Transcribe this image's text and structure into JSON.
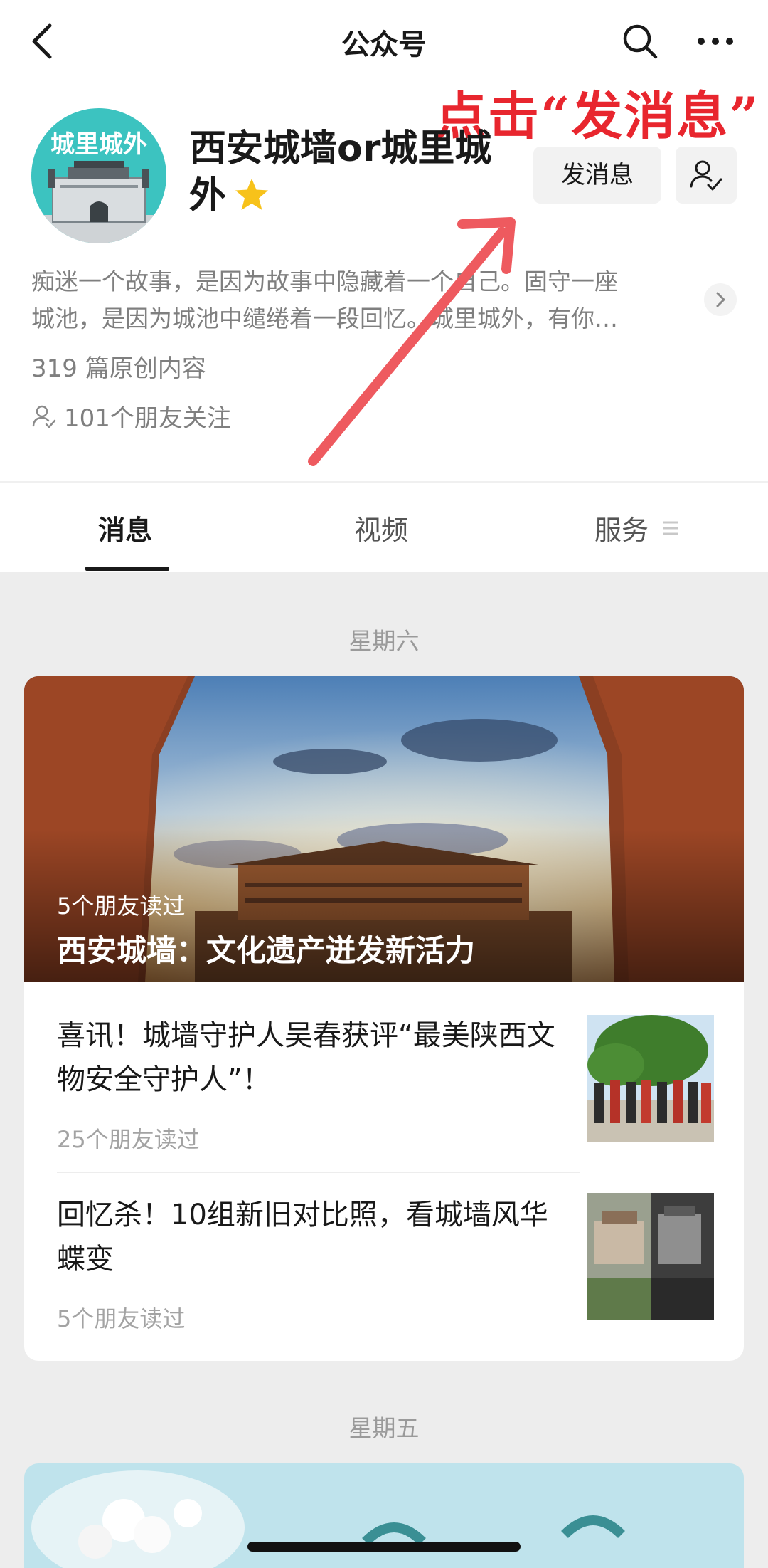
{
  "navbar": {
    "title": "公众号"
  },
  "annotation": {
    "text": "点击“发消息”",
    "color": "#e8262e"
  },
  "profile": {
    "avatar_text": "城里城外",
    "name": "西安城墙or城里城外",
    "message_button": "发消息",
    "description_lines": [
      "痴迷一个故事，是因为故事中隐藏着一个自己。固守一座",
      "城池，是因为城池中缱绻着一段回忆。城里城外，有你…"
    ],
    "article_count": "319 篇原创内容",
    "friends_following": "101个朋友关注"
  },
  "tabs": [
    {
      "label": "消息",
      "active": true
    },
    {
      "label": "视频",
      "active": false
    },
    {
      "label": "服务",
      "active": false
    }
  ],
  "feed": {
    "day_1": "星期六",
    "featured": {
      "reads": "5个朋友读过",
      "title": "西安城墙：文化遗产迸发新活力"
    },
    "articles": [
      {
        "title": "喜讯！城墙守护人吴春获评“最美陕西文物安全守护人”！",
        "reads": "25个朋友读过"
      },
      {
        "title": "回忆杀！10组新旧对比照，看城墙风华蝶变",
        "reads": "5个朋友读过"
      }
    ],
    "day_2": "星期五"
  },
  "colors": {
    "background": "#ededed",
    "card": "#ffffff",
    "avatar_bg": "#3cc3c0",
    "star": "#f7c21a"
  }
}
